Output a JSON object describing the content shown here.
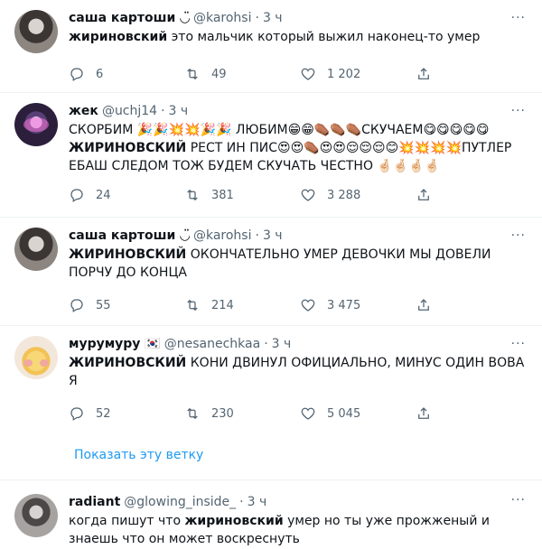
{
  "tweets": [
    {
      "name": "саша картоши ◡̈",
      "handle": "@karohsi",
      "time": "3 ч",
      "bold": "жириновский",
      "text": " это мальчик который выжил наконец-то умер",
      "replies": "6",
      "retweets": "49",
      "likes": "1 202"
    },
    {
      "name": "жек",
      "handle": "@uchj14",
      "time": "3 ч",
      "text_before": "СКОРБИМ 🎉🎉💥💥🎉🎉 ЛЮБИМ😁😁⚰️⚰️⚰️СКУЧАЕМ😋😋😋😋😋 ",
      "bold": "ЖИРИНОВСКИЙ",
      "text_after": " РЕСТ ИН ПИС😍😍⚰️😍😍😌😌😌😊💥💥💥💥ПУТЛЕР ЕБАШ СЛЕДОМ ТОЖ БУДЕМ СКУЧАТЬ ЧЕСТНО 🤞🏻🤞🏻🤞🏻🤞🏻",
      "replies": "24",
      "retweets": "381",
      "likes": "3 288"
    },
    {
      "name": "саша картоши ◡̈",
      "handle": "@karohsi",
      "time": "3 ч",
      "bold": "ЖИРИНОВСКИЙ",
      "text": " ОКОНЧАТЕЛЬНО УМЕР ДЕВОЧКИ МЫ ДОВЕЛИ ПОРЧУ ДО КОНЦА",
      "replies": "55",
      "retweets": "214",
      "likes": "3 475"
    },
    {
      "name": "мурумуру 🇰🇷",
      "handle": "@nesanechkaa",
      "time": "3 ч",
      "bold": "ЖИРИНОВСКИЙ",
      "text": " КОНИ ДВИНУЛ ОФИЦИАЛЬНО, МИНУС ОДИН ВОВА Я",
      "replies": "52",
      "retweets": "230",
      "likes": "5 045"
    },
    {
      "name": "radiant",
      "handle": "@glowing_inside_",
      "time": "3 ч",
      "text_before": "когда пишут что ",
      "bold": "жириновский",
      "text_after": " умер но ты уже прожженый и знаешь что он может воскреснуть"
    }
  ],
  "thread_link": "Показать эту ветку",
  "more_glyph": "···",
  "colors": {
    "link": "#1d9bf0",
    "muted": "#536471",
    "text": "#0f1419",
    "divider": "#eff3f4"
  }
}
